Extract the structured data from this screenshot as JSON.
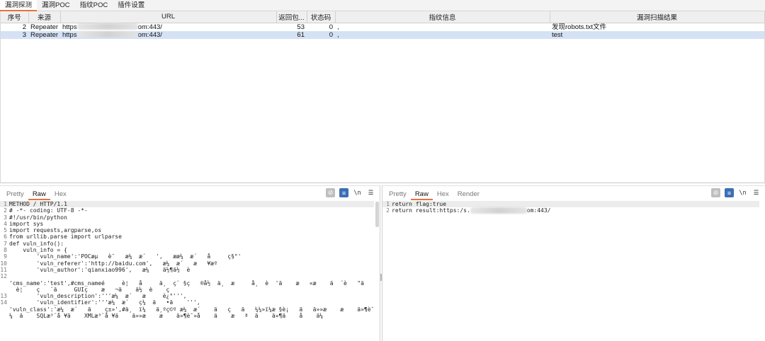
{
  "top_tabs": [
    "漏洞探测",
    "漏洞POC",
    "指纹POC",
    "插件设置"
  ],
  "table": {
    "columns": [
      "序号",
      "来源",
      "URL",
      "返回包...",
      "状态码",
      "指纹信息",
      "漏洞扫描结果"
    ],
    "rows": [
      {
        "id": "2",
        "source": "Repeater",
        "url_prefix": "https",
        "url_suffix": "om:443/",
        "length": "53",
        "status": "0",
        "fingerprint": ",",
        "result": "发现robots.txt文件",
        "selected": false
      },
      {
        "id": "3",
        "source": "Repeater",
        "url_prefix": "https",
        "url_suffix": "om:443/",
        "length": "61",
        "status": "0",
        "fingerprint": ",",
        "result": "test",
        "selected": true
      }
    ]
  },
  "left_pane": {
    "tabs": [
      "Pretty",
      "Raw",
      "Hex"
    ],
    "active_tab": "Raw",
    "lines": [
      {
        "n": "1",
        "t": "METHOD / HTTP/1.1"
      },
      {
        "n": "2",
        "t": "# -*- coding: UTF-8 -*-"
      },
      {
        "n": "3",
        "t": "#!/usr/bin/python"
      },
      {
        "n": "4",
        "t": "import sys"
      },
      {
        "n": "5",
        "t": "import requests,argparse,os"
      },
      {
        "n": "6",
        "t": "from urllib.parse import urlparse"
      },
      {
        "n": "7",
        "t": "def vuln_info():"
      },
      {
        "n": "8",
        "t": "    vuln_info = {"
      },
      {
        "n": "9",
        "t": "        'vuln_name':'POCæµ   è¯   æ¼  æ´   ',   ææ¼  æ´   å     ç§°'"
      },
      {
        "n": "10",
        "t": "        'vuln_referer':'http://baidu.com',   æ¼  æ´   æ   ¥æº"
      },
      {
        "n": "11",
        "t": "        'vuln_author':'qianxiao996',   æ¼    ä½¶ä½  è"
      },
      {
        "n": "12",
        "t": ""
      },
      {
        "n": "",
        "t": "'cms_name':'test',#cms_nameé     è¦   å     ä¸  ç¨ §ç   ®å½  ä¸  æ     å¸  è  'ä    æ   «æ    ä  ¨è   \"ä   'æ•»å    ä¼"
      },
      {
        "n": "",
        "t": "  è¦    ç   ¨ä     GUIç    æ   ¬ä    ä½  è    ç    "
      },
      {
        "n": "13",
        "t": "        'vuln_description':'''æ¼  æ´   æ     è¿°''',"
      },
      {
        "n": "14",
        "t": "        'vuln_identifier':'''æ¼  æ´   ç¼  ä   •ä    ''',"
      },
      {
        "n": "",
        "t": ""
      },
      {
        "n": "",
        "t": "'vuln_class':'æ¼  æ´   ä    ç±»',#ä¸  ï¼   ä¸ºç©º æ¼  æ´    ä   ç   ä   ¼¼»ï¼æ §è¡   ä   ä»»æ    æ    ä»¶è¯»ä"
      },
      {
        "n": "",
        "t": "¼  ä    SQLæ³¨å ¥ä    XMLæ³¨å ¥ä    ä»»æ    æ    ä»¶è¯»å    ä    æ   ª  ä    ä»¶ä    å    ä¼"
      }
    ]
  },
  "right_pane": {
    "tabs": [
      "Pretty",
      "Raw",
      "Hex",
      "Render"
    ],
    "active_tab": "Raw",
    "lines": [
      {
        "n": "1",
        "t": "return flag:true"
      },
      {
        "n": "2",
        "t_prefix": "return result:https:/s.",
        "t_suffix": "om:443/"
      }
    ]
  },
  "tool_icons": {
    "hide": "eye-off-icon",
    "wrap": "wrap-icon",
    "newline": "\\n",
    "menu": "hamburger-icon"
  },
  "colors": {
    "accent": "#e8733a",
    "selection": "#d5e2f5",
    "tool_blue": "#3b6fb5"
  }
}
